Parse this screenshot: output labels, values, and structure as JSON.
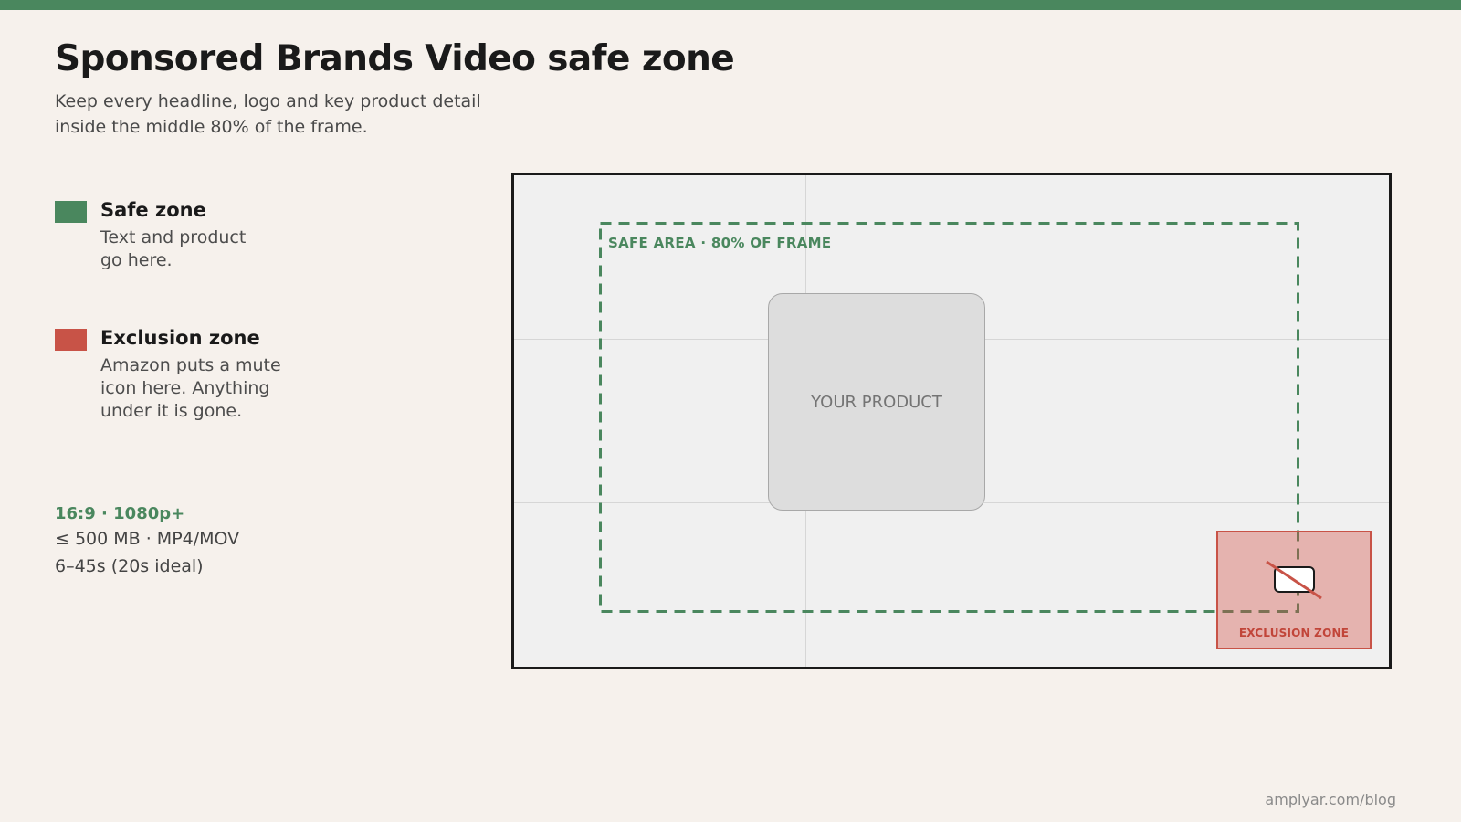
{
  "title": "Sponsored Brands Video safe zone",
  "subtitle": "Keep every headline, logo and key product detail\ninside the middle 80% of the frame.",
  "legend": {
    "safe": {
      "title": "Safe zone",
      "description": "Text and product\ngo here."
    },
    "exclusion": {
      "title": "Exclusion zone",
      "description": "Amazon puts a mute\nicon here. Anything\nunder it is gone."
    }
  },
  "specs": {
    "headline": "16:9 · 1080p+",
    "lines": [
      "≤ 500 MB · MP4/MOV",
      "6–45s (20s ideal)"
    ]
  },
  "diagram": {
    "safe_label": "SAFE AREA · 80% OF FRAME",
    "product_label": "YOUR PRODUCT",
    "exclusion_label": "EXCLUSION ZONE"
  },
  "footer": "amplyar.com/blog",
  "colors": {
    "safe": "#4a875e",
    "exclusion": "#c85347",
    "background": "#f6f1ec",
    "frame": "#f0f0f0"
  },
  "icons": [
    "mute-icon"
  ]
}
